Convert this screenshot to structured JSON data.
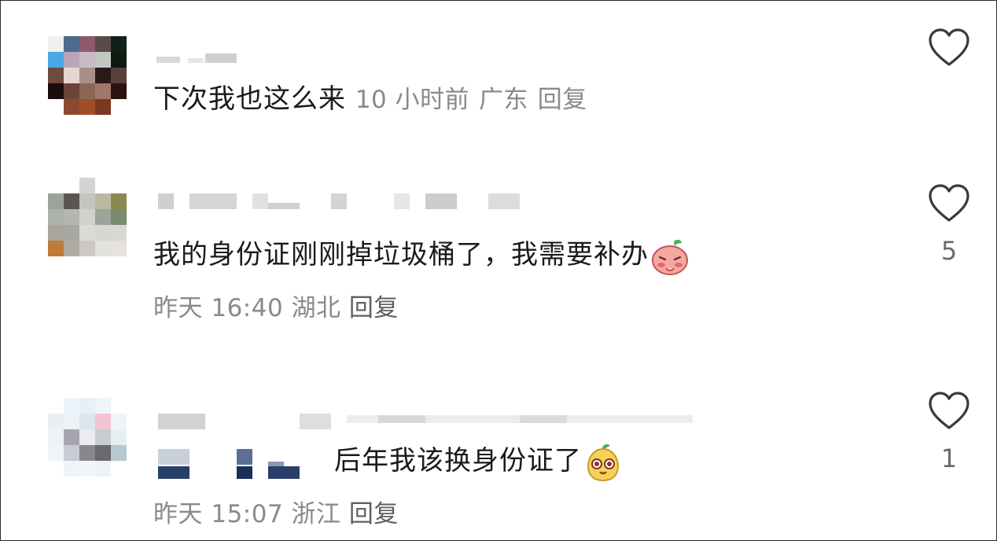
{
  "comments": [
    {
      "text": "下次我也这么来",
      "time": "10 小时前",
      "location": "广东",
      "reply": "回复",
      "likes": ""
    },
    {
      "text": "我的身份证刚刚掉垃圾桶了，我需要补办",
      "time": "昨天 16:40",
      "location": "湖北",
      "reply": "回复",
      "likes": "5"
    },
    {
      "text": "后年我该换身份证了",
      "time": "昨天 15:07",
      "location": "浙江",
      "reply": "回复",
      "likes": "1"
    }
  ],
  "icons": {
    "like": "heart-outline-icon",
    "emoji_comment_2": "pleading-peach-emoji",
    "emoji_comment_3": "yellow-pear-face-emoji"
  },
  "colors": {
    "text": "#1a1a1a",
    "meta": "#8a8a8a",
    "reply": "#5f5f5f",
    "icon": "#3a3a3a"
  }
}
